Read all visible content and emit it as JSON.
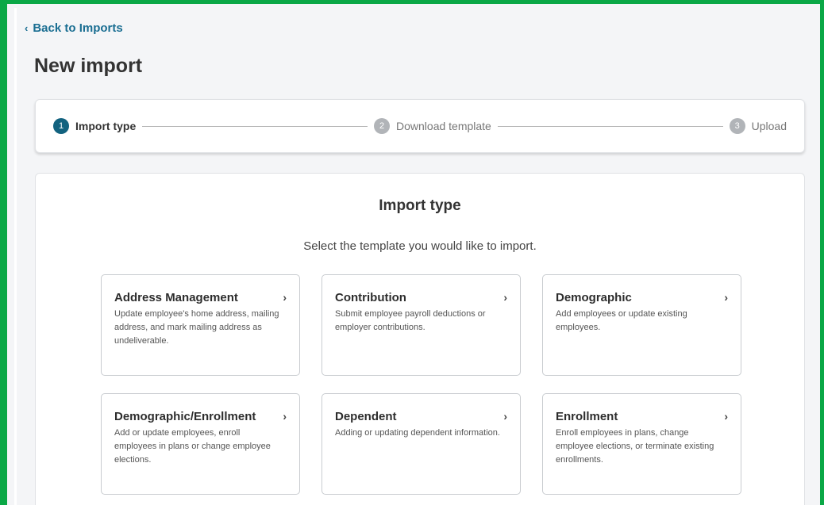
{
  "nav": {
    "back_label": "Back to Imports",
    "back_icon": "chevron-left"
  },
  "page": {
    "title": "New import"
  },
  "stepper": {
    "steps": [
      {
        "number": "1",
        "label": "Import type",
        "state": "active"
      },
      {
        "number": "2",
        "label": "Download template",
        "state": "inactive"
      },
      {
        "number": "3",
        "label": "Upload",
        "state": "inactive"
      }
    ]
  },
  "import_panel": {
    "title": "Import type",
    "subtitle": "Select the template you would like to import.",
    "cards": [
      {
        "title": "Address Management",
        "description": "Update employee's home address, mailing address, and mark mailing address as undeliverable."
      },
      {
        "title": "Contribution",
        "description": "Submit employee payroll deductions or employer contributions."
      },
      {
        "title": "Demographic",
        "description": "Add employees or update existing employees."
      },
      {
        "title": "Demographic/Enrollment",
        "description": "Add or update employees, enroll employees in plans or change employee elections."
      },
      {
        "title": "Dependent",
        "description": "Adding or updating dependent information."
      },
      {
        "title": "Enrollment",
        "description": "Enroll employees in plans, change employee elections, or terminate existing enrollments."
      }
    ]
  },
  "colors": {
    "frame_border": "#0aa846",
    "link": "#1a6e92",
    "step_active": "#12627f",
    "step_inactive": "#b1b4b8"
  }
}
